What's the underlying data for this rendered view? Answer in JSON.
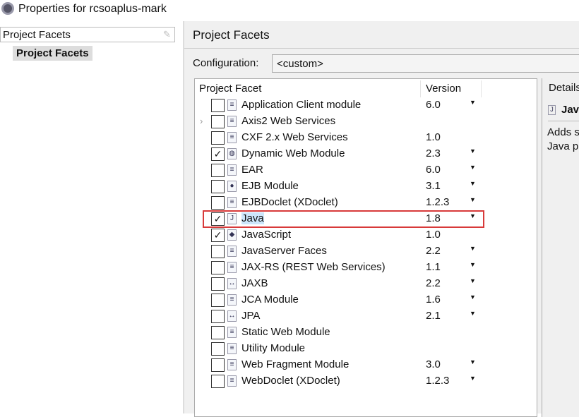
{
  "window": {
    "title": "Properties for rcsoaplus-mark"
  },
  "sidebar": {
    "filter_value": "Project Facets",
    "items": [
      {
        "label": "Project Facets"
      }
    ]
  },
  "page": {
    "title": "Project Facets",
    "configuration_label": "Configuration:",
    "configuration_value": "<custom>"
  },
  "table": {
    "headers": [
      "Project Facet",
      "Version"
    ],
    "rows": [
      {
        "name": "Application Client module",
        "version": "6.0",
        "checked": false,
        "dropdown": true,
        "icon": "doc-icon"
      },
      {
        "name": "Axis2 Web Services",
        "version": "",
        "checked": false,
        "dropdown": false,
        "icon": "doc-icon",
        "expandable": true
      },
      {
        "name": "CXF 2.x Web Services",
        "version": "1.0",
        "checked": false,
        "dropdown": false,
        "icon": "doc-icon"
      },
      {
        "name": "Dynamic Web Module",
        "version": "2.3",
        "checked": true,
        "dropdown": true,
        "icon": "web-module-icon"
      },
      {
        "name": "EAR",
        "version": "6.0",
        "checked": false,
        "dropdown": true,
        "icon": "doc-icon"
      },
      {
        "name": "EJB Module",
        "version": "3.1",
        "checked": false,
        "dropdown": true,
        "icon": "ejb-icon"
      },
      {
        "name": "EJBDoclet (XDoclet)",
        "version": "1.2.3",
        "checked": false,
        "dropdown": true,
        "icon": "doc-icon"
      },
      {
        "name": "Java",
        "version": "1.8",
        "checked": true,
        "dropdown": true,
        "icon": "java-icon",
        "selected": true
      },
      {
        "name": "JavaScript",
        "version": "1.0",
        "checked": true,
        "dropdown": false,
        "icon": "javascript-icon"
      },
      {
        "name": "JavaServer Faces",
        "version": "2.2",
        "checked": false,
        "dropdown": true,
        "icon": "doc-icon"
      },
      {
        "name": "JAX-RS (REST Web Services)",
        "version": "1.1",
        "checked": false,
        "dropdown": true,
        "icon": "doc-icon"
      },
      {
        "name": "JAXB",
        "version": "2.2",
        "checked": false,
        "dropdown": true,
        "icon": "jaxb-icon"
      },
      {
        "name": "JCA Module",
        "version": "1.6",
        "checked": false,
        "dropdown": true,
        "icon": "doc-icon"
      },
      {
        "name": "JPA",
        "version": "2.1",
        "checked": false,
        "dropdown": true,
        "icon": "jpa-icon"
      },
      {
        "name": "Static Web Module",
        "version": "",
        "checked": false,
        "dropdown": false,
        "icon": "doc-icon"
      },
      {
        "name": "Utility Module",
        "version": "",
        "checked": false,
        "dropdown": false,
        "icon": "doc-icon"
      },
      {
        "name": "Web Fragment Module",
        "version": "3.0",
        "checked": false,
        "dropdown": true,
        "icon": "doc-icon"
      },
      {
        "name": "WebDoclet (XDoclet)",
        "version": "1.2.3",
        "checked": false,
        "dropdown": true,
        "icon": "doc-icon"
      }
    ]
  },
  "details": {
    "tab": "Details",
    "facet": "Java",
    "description_line1": "Adds s",
    "description_line2": "Java p"
  },
  "colors": {
    "highlight": "#d83a3a",
    "selection": "#cde6fb"
  }
}
